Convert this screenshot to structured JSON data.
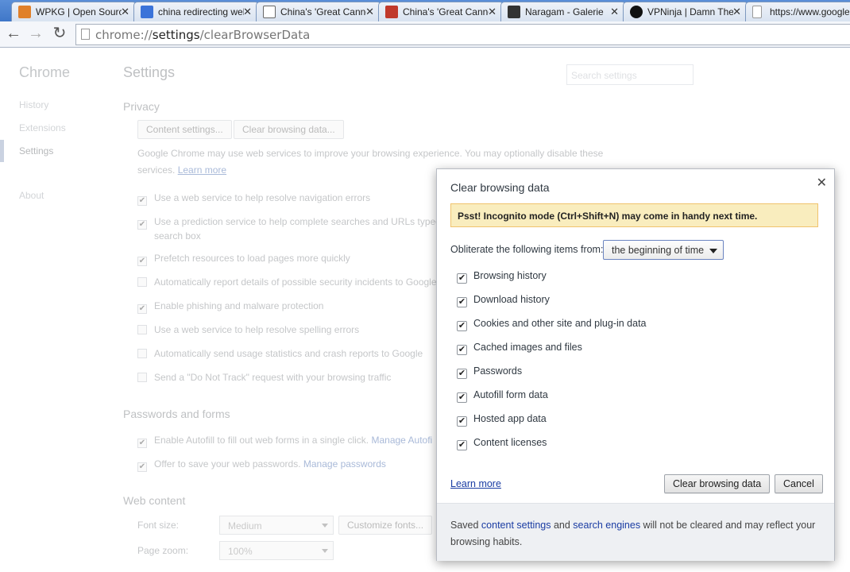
{
  "tabs": [
    {
      "title": "WPKG | Open Source",
      "icon": "wpkg-favicon-icon",
      "color": "#e0802a"
    },
    {
      "title": "china redirecting web",
      "icon": "google-favicon-icon",
      "color": "#3b73d9"
    },
    {
      "title": "China's 'Great Canno",
      "icon": "verge-favicon-icon",
      "color": "#666666"
    },
    {
      "title": "China's 'Great Canno",
      "icon": "usn-favicon-icon",
      "color": "#c0392b"
    },
    {
      "title": "Naragam - Galerie",
      "icon": "naragam-favicon-icon",
      "color": "#333333"
    },
    {
      "title": "VPNinja | Damn The",
      "icon": "vpninja-favicon-icon",
      "color": "#111111"
    },
    {
      "title": "https://www.google",
      "icon": "page-favicon-icon",
      "color": "#999999"
    }
  ],
  "toolbar": {
    "url_prefix": "chrome://",
    "url_host": "settings",
    "url_path": "/clearBrowserData"
  },
  "settings": {
    "brand": "Chrome",
    "nav": {
      "history": "History",
      "extensions": "Extensions",
      "settings": "Settings",
      "about": "About"
    },
    "title": "Settings",
    "search_placeholder": "Search settings",
    "privacy": {
      "heading": "Privacy",
      "content_settings": "Content settings...",
      "clear_browsing_data": "Clear browsing data...",
      "description": "Google Chrome may use web services to improve your browsing experience. You may optionally disable these services.",
      "learn_more": "Learn more",
      "options": [
        {
          "label": "Use a web service to help resolve navigation errors",
          "checked": true
        },
        {
          "label": "Use a prediction service to help complete searches and URLs typed",
          "label2": "search box",
          "checked": true
        },
        {
          "label": "Prefetch resources to load pages more quickly",
          "checked": true
        },
        {
          "label": "Automatically report details of possible security incidents to Google",
          "checked": false
        },
        {
          "label": "Enable phishing and malware protection",
          "checked": true
        },
        {
          "label": "Use a web service to help resolve spelling errors",
          "checked": false
        },
        {
          "label": "Automatically send usage statistics and crash reports to Google",
          "checked": false
        },
        {
          "label": "Send a \"Do Not Track\" request with your browsing traffic",
          "checked": false
        }
      ]
    },
    "passwords": {
      "heading": "Passwords and forms",
      "autofill": "Enable Autofill to fill out web forms in a single click.",
      "manage_autofill": "Manage Autofi",
      "save_passwords": "Offer to save your web passwords.",
      "manage_passwords": "Manage passwords"
    },
    "web_content": {
      "heading": "Web content",
      "font_size_label": "Font size:",
      "font_size_value": "Medium",
      "customize_fonts": "Customize fonts...",
      "page_zoom_label": "Page zoom:",
      "page_zoom_value": "100%"
    }
  },
  "dialog": {
    "title": "Clear browsing data",
    "banner": "Psst! Incognito mode (Ctrl+Shift+N) may come in handy next time.",
    "obliterate_label": "Obliterate the following items from:",
    "time_range": "the beginning of time",
    "items": [
      {
        "label": "Browsing history",
        "checked": true
      },
      {
        "label": "Download history",
        "checked": true
      },
      {
        "label": "Cookies and other site and plug-in data",
        "checked": true
      },
      {
        "label": "Cached images and files",
        "checked": true
      },
      {
        "label": "Passwords",
        "checked": true
      },
      {
        "label": "Autofill form data",
        "checked": true
      },
      {
        "label": "Hosted app data",
        "checked": true
      },
      {
        "label": "Content licenses",
        "checked": true
      }
    ],
    "learn_more": "Learn more",
    "clear_button": "Clear browsing data",
    "cancel_button": "Cancel",
    "footer_pre": "Saved ",
    "footer_link1": "content settings",
    "footer_mid": " and ",
    "footer_link2": "search engines",
    "footer_post": " will not be cleared and may reflect your browsing habits."
  }
}
